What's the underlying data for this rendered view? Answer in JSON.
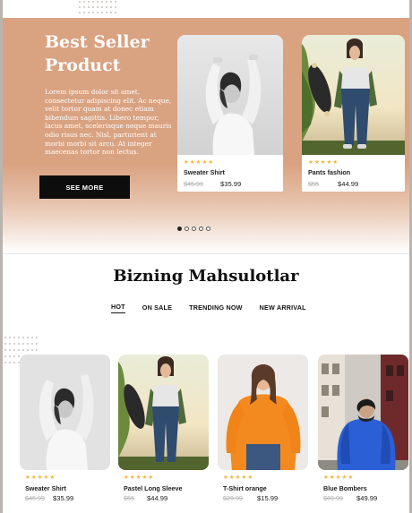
{
  "hero": {
    "title_line1": "Best Seller",
    "title_line2": "Product",
    "description": "Lorem ipsum dolor sit amet, consectetur adipiscing elit. Ac neque, velit tortor quam at donec etiam bibendum sagittis. Libero tempor, lacus amet, scelerisque neque mauris odio risus nec. Nisl, parturient at morbi morbi sit arcu. At integer maecenas tortor non lectus.",
    "button_label": "SEE MORE",
    "cards": [
      {
        "name": "Sweater Shirt",
        "old_price": "$45.99",
        "price": "$35.99",
        "rating": 5
      },
      {
        "name": "Pants fashion",
        "old_price": "$55",
        "price": "$44.99",
        "rating": 5
      }
    ],
    "carousel": {
      "count": 5,
      "active_index": 0
    }
  },
  "section": {
    "title": "Bizning Mahsulotlar",
    "tabs": [
      "HOT",
      "ON SALE",
      "TRENDING NOW",
      "NEW ARRIVAL"
    ],
    "active_tab": "HOT"
  },
  "products": [
    {
      "name": "Sweater Shirt",
      "old_price": "$45.99",
      "price": "$35.99",
      "rating": 5
    },
    {
      "name": "Pastel Long Sleeve",
      "old_price": "$55",
      "price": "$44.99",
      "rating": 5
    },
    {
      "name": "T-Shirt orange",
      "old_price": "$29.99",
      "price": "$15.99",
      "rating": 5
    },
    {
      "name": "Blue Bombers",
      "old_price": "$69.99",
      "price": "$49.99",
      "rating": 5
    }
  ],
  "icons": {
    "star": "star-icon",
    "carousel_dot": "carousel-dot-icon"
  },
  "colors": {
    "hero_bg": "#d9a281",
    "button_bg": "#0d0d0d",
    "star": "#f3b53b"
  }
}
